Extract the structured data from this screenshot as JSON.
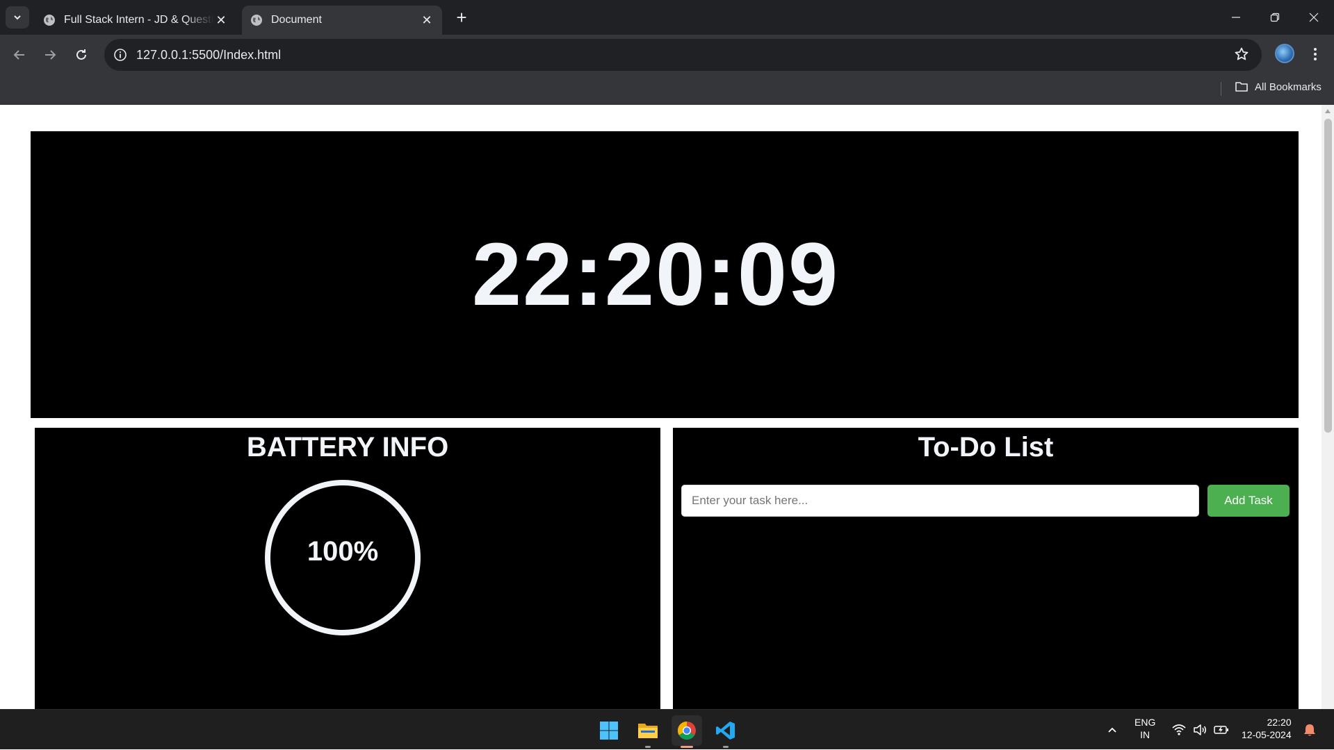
{
  "browser": {
    "tabs": [
      {
        "title": "Full Stack Intern - JD & Questio",
        "active": false
      },
      {
        "title": "Document",
        "active": true
      }
    ],
    "url": "127.0.0.1:5500/Index.html",
    "bookmarks_label": "All Bookmarks"
  },
  "page": {
    "clock_time": "22:20:09",
    "battery": {
      "title": "BATTERY INFO",
      "percent_label": "100%",
      "level": 1.0
    },
    "todo": {
      "title": "To-Do List",
      "input_placeholder": "Enter your task here...",
      "input_value": "",
      "add_button_label": "Add Task",
      "add_button_color": "#4caf50"
    }
  },
  "taskbar": {
    "apps": [
      "windows-start-icon",
      "file-explorer-icon",
      "chrome-icon",
      "vscode-icon"
    ],
    "language_line1": "ENG",
    "language_line2": "IN",
    "time": "22:20",
    "date": "12-05-2024"
  }
}
